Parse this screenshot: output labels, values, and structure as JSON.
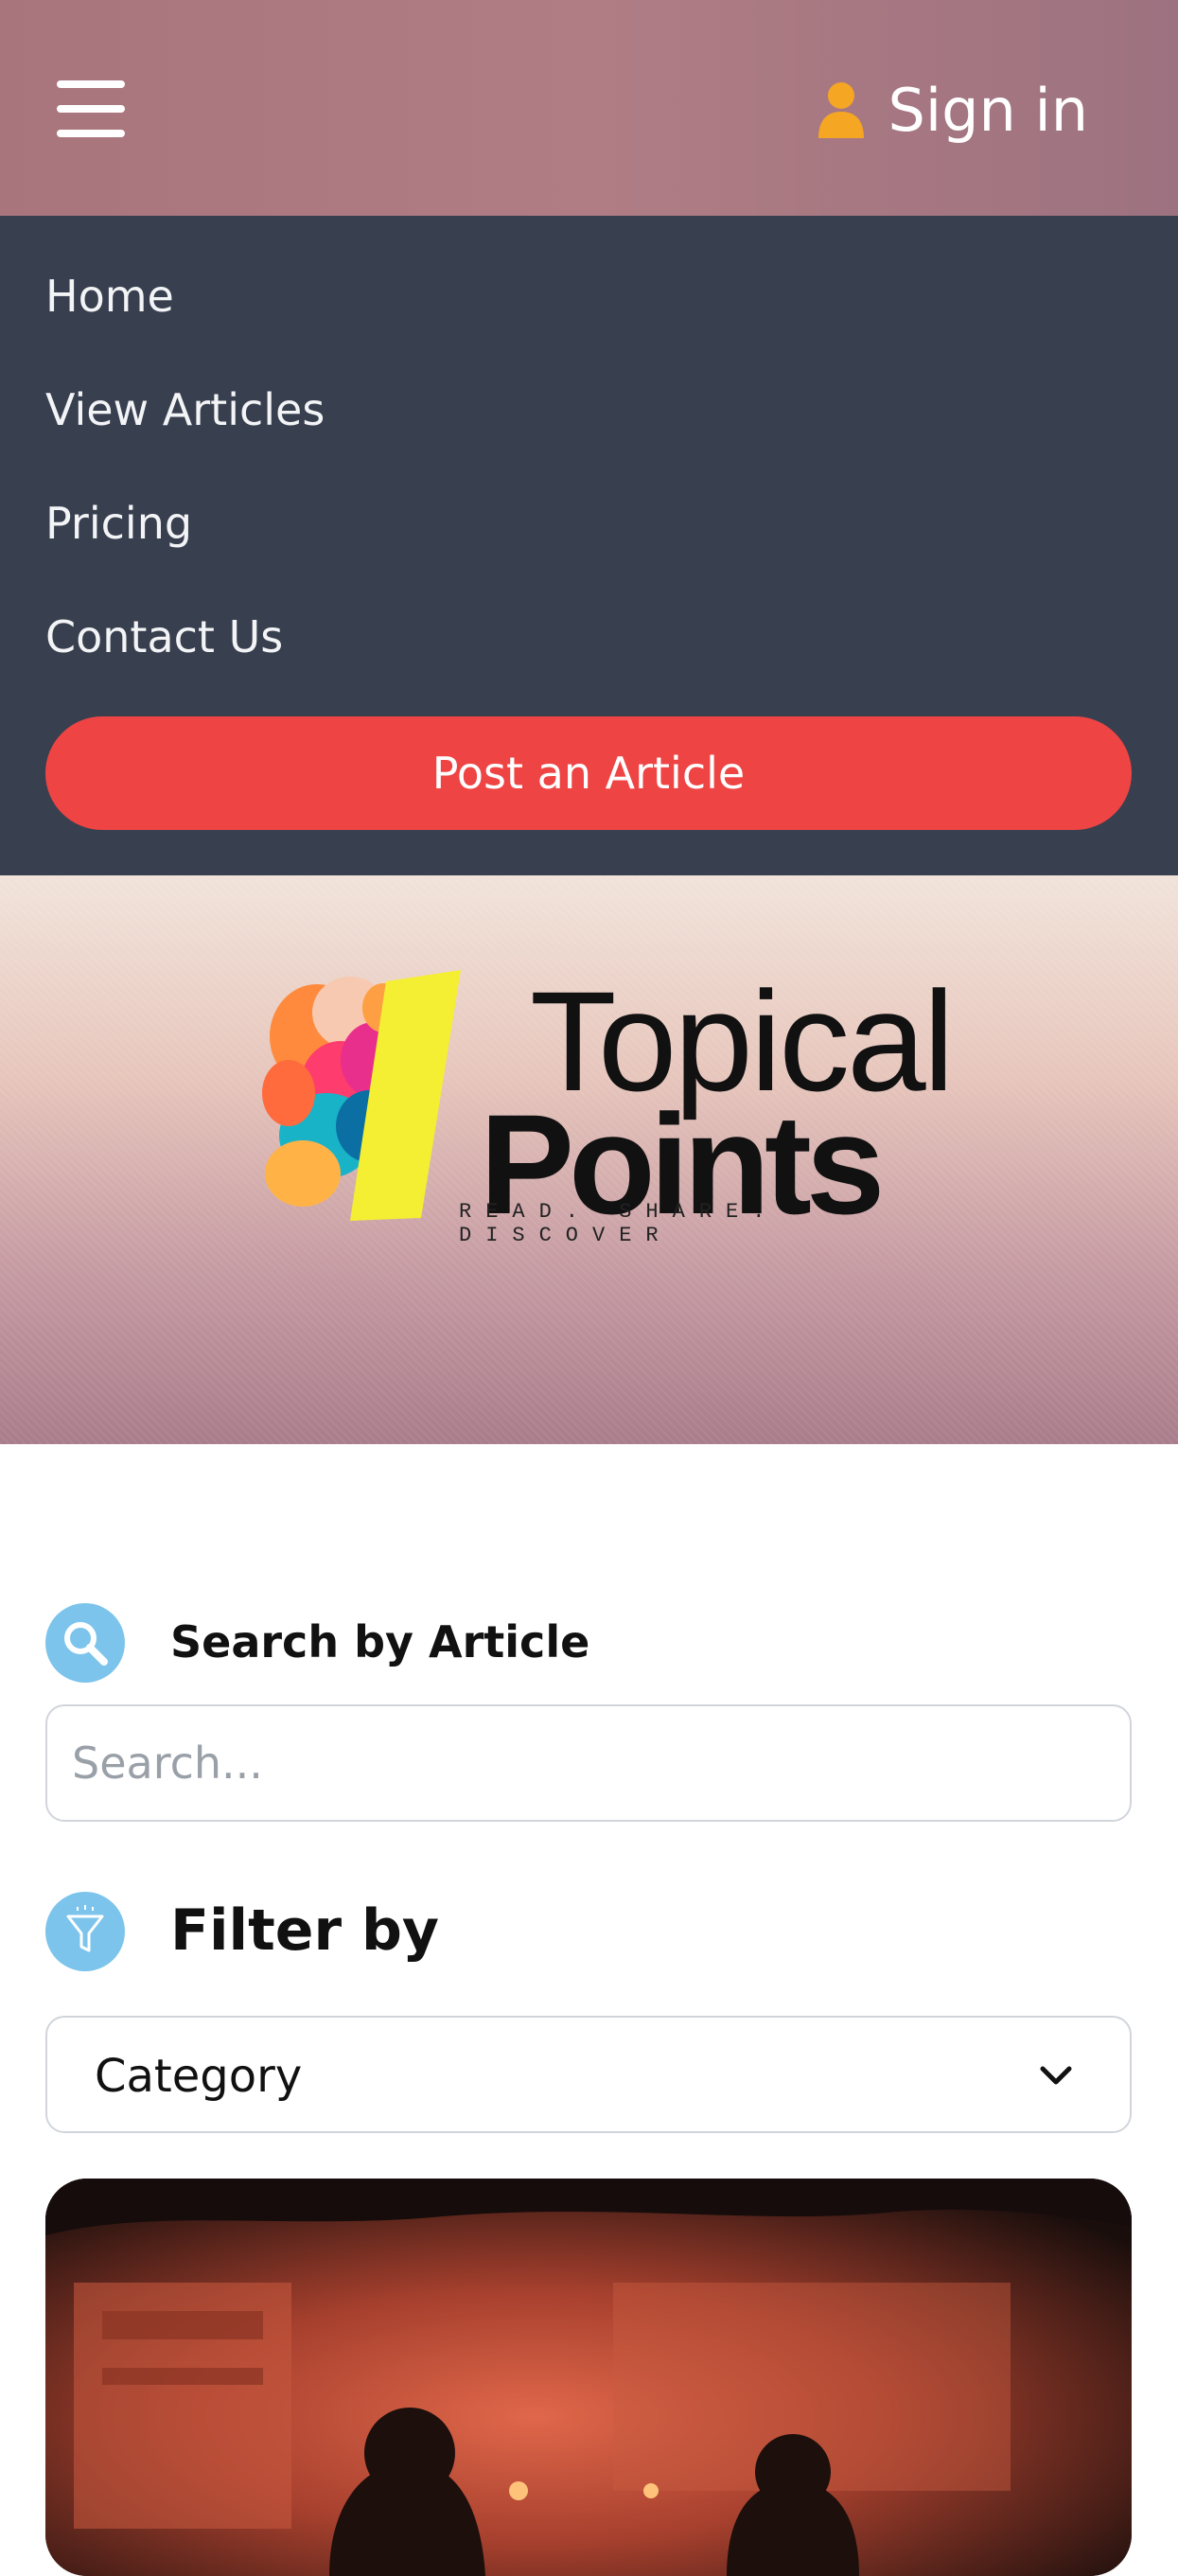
{
  "header": {
    "menu_icon": "hamburger-icon",
    "signin_icon": "user-icon",
    "signin_label": "Sign in",
    "colors": {
      "background": "#a9757d",
      "user_icon": "#f5a623"
    }
  },
  "menu": {
    "items": [
      {
        "label": "Home"
      },
      {
        "label": "View Articles"
      },
      {
        "label": "Pricing"
      },
      {
        "label": "Contact Us"
      }
    ],
    "post_button": "Post an Article",
    "colors": {
      "background": "#383f4f",
      "post_button": "#ef4444"
    }
  },
  "hero": {
    "logo": {
      "word1": "Topical",
      "word2": "Points",
      "tagline": "READ. SHARE. DISCOVER"
    }
  },
  "search": {
    "icon": "search-icon",
    "title": "Search by Article",
    "placeholder": "Search...",
    "value": ""
  },
  "filter": {
    "icon": "filter-icon",
    "title": "Filter by",
    "selected": "Category",
    "dropdown_icon": "chevron-down-icon",
    "colors": {
      "icon_circle": "#7cc4ec"
    }
  },
  "article_card": {
    "image": "night-desert-scene"
  }
}
